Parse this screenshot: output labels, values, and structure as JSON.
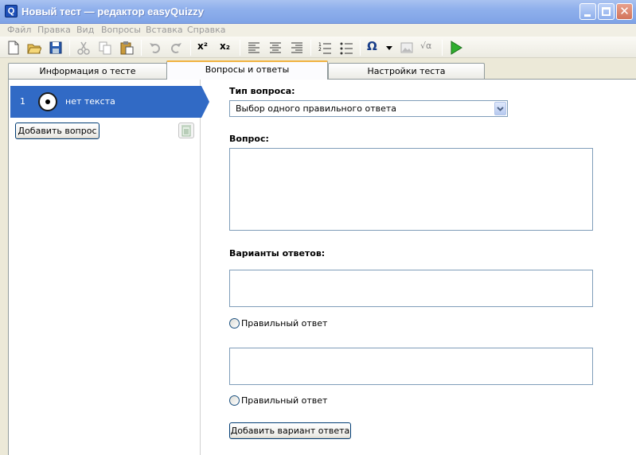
{
  "window": {
    "title": "Новый тест — редактор easyQuizzy",
    "app_icon_letter": "Q"
  },
  "menu": [
    "Файл",
    "Правка",
    "Вид",
    "Вопросы",
    "Вставка",
    "Справка"
  ],
  "toolbar_icons": [
    "new-icon",
    "open-icon",
    "save-icon",
    "cut-icon",
    "copy-icon",
    "paste-icon",
    "undo-icon",
    "redo-icon",
    "superscript-icon",
    "subscript-icon",
    "align-left-icon",
    "align-center-icon",
    "align-right-icon",
    "numbered-list-icon",
    "bulleted-list-icon",
    "omega-symbol-icon",
    "image-icon",
    "formula-icon",
    "run-icon"
  ],
  "toolbar_text": {
    "superscript": "x²",
    "subscript": "x₂",
    "omega": "Ω",
    "formula": "√α"
  },
  "tabs": [
    {
      "label": "Информация о тесте",
      "active": false
    },
    {
      "label": "Вопросы и ответы",
      "active": true
    },
    {
      "label": "Настройки теста",
      "active": false
    }
  ],
  "questions": [
    {
      "number": "1",
      "text": "нет текста",
      "selected": true
    }
  ],
  "left_panel": {
    "add_question_label": "Добавить вопрос"
  },
  "form": {
    "question_type_label": "Тип вопроса:",
    "question_type_value": "Выбор одного правильного ответа",
    "question_label": "Вопрос:",
    "question_text": "",
    "answers_label": "Варианты ответов:",
    "answers": [
      {
        "text": "",
        "correct_label": "Правильный ответ",
        "correct": false
      },
      {
        "text": "",
        "correct_label": "Правильный ответ",
        "correct": false
      }
    ],
    "add_answer_label": "Добавить вариант ответа"
  },
  "colors": {
    "selection": "#316ac5",
    "title_gradient": "#8fb0ec",
    "active_tab_accent": "#f1b341"
  }
}
